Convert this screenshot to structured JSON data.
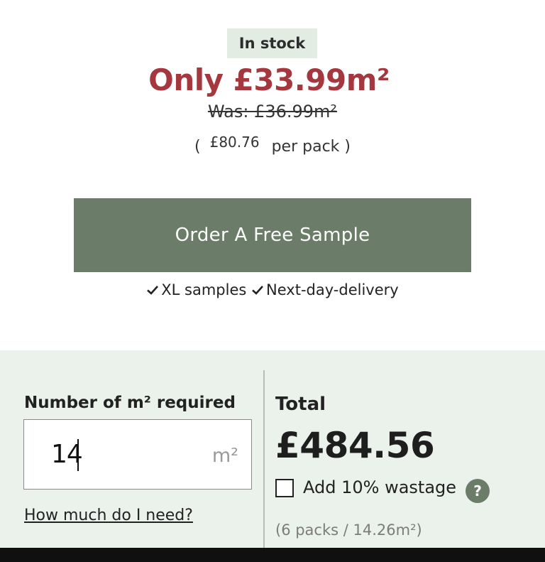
{
  "stock": {
    "label": "In stock",
    "bg_color": "#e3ece3"
  },
  "price": {
    "now": "Only £33.99m²",
    "now_color": "#a5383e",
    "was": "Was: £36.99m²",
    "pack_open": "(",
    "pack_amount": "£80.76",
    "pack_suffix": "per pack",
    "pack_close": ")"
  },
  "sample": {
    "button_label": "Order A Free Sample",
    "button_color": "#6b7d68"
  },
  "features": {
    "icon": "checkmark-icon",
    "items": [
      "XL samples",
      "Next-day-delivery"
    ]
  },
  "calculator": {
    "panel_color": "#ebf1eb",
    "qty_label": "Number of m² required",
    "qty_value": "14",
    "qty_unit": "m²",
    "help_link": "How much do I need?",
    "total_label": "Total",
    "total_value": "£484.56",
    "wastage_label": "Add 10% wastage",
    "wastage_checked": false,
    "help_icon": "?",
    "packs_info": "(6 packs / 14.26m²)"
  }
}
